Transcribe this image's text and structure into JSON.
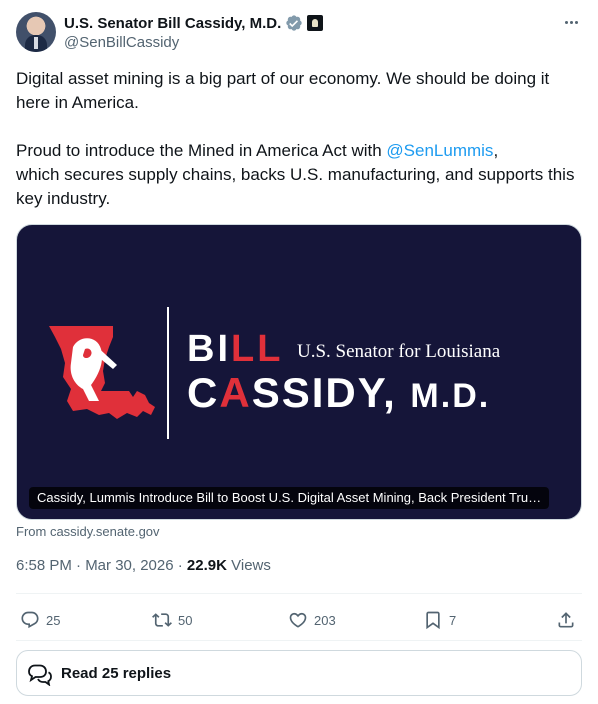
{
  "author": {
    "name": "U.S. Senator Bill Cassidy, M.D.",
    "handle": "@SenBillCassidy",
    "verified_color": "#829aab"
  },
  "tweet": {
    "line1": "Digital asset mining is a big part of our economy. We should be doing it here in America.",
    "line2_before": "Proud to introduce the Mined in America Act with ",
    "mention": "@SenLummis",
    "line2_after": ",",
    "line3": "which secures supply chains, backs U.S. manufacturing, and supports this key industry."
  },
  "card": {
    "logo_first": "BILL",
    "logo_subtitle": "U.S. Senator for Louisiana",
    "logo_last": "CASSIDY, M.D.",
    "title": "Cassidy, Lummis Introduce Bill to Boost U.S. Digital Asset Mining, Back President Tru…",
    "source": "From cassidy.senate.gov",
    "background_color": "#151539",
    "accent_color": "#e0303a"
  },
  "meta": {
    "timestamp": "6:58 PM · Mar 30, 2026 · ",
    "views_count": "22.9K",
    "views_label": "Views"
  },
  "actions": {
    "replies": "25",
    "reposts": "50",
    "likes": "203",
    "bookmarks": "7"
  },
  "read_replies": "Read 25 replies",
  "icons": [
    "verified-badge-icon",
    "government-badge-icon",
    "more-icon",
    "reply-icon",
    "repost-icon",
    "like-icon",
    "bookmark-icon",
    "share-icon",
    "replies-bubble-icon"
  ]
}
